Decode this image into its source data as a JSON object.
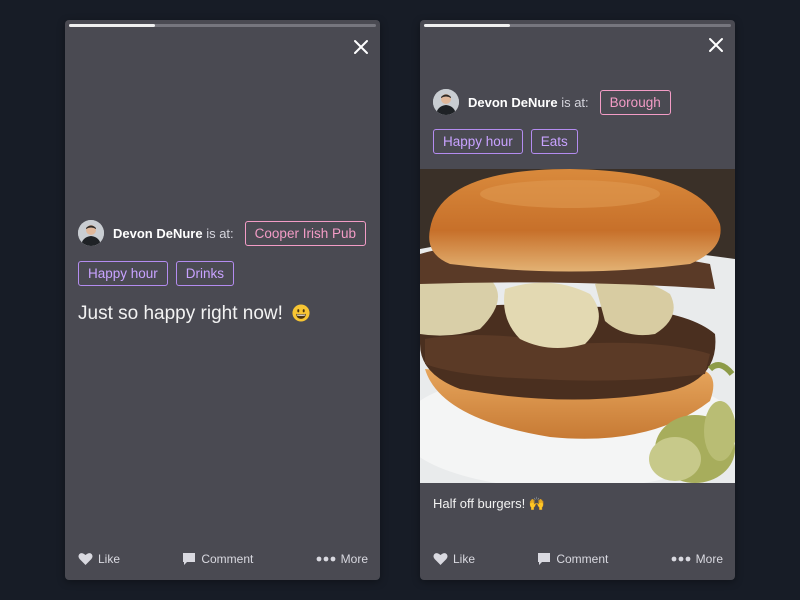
{
  "cards": [
    {
      "progress": 0.28,
      "user": {
        "name": "Devon DeNure",
        "is_at": "is at:"
      },
      "location": "Cooper Irish Pub",
      "tags": [
        "Happy hour",
        "Drinks"
      ],
      "status_text": "Just so happy right now!",
      "status_emoji": "grinning-face",
      "actions": {
        "like": "Like",
        "comment": "Comment",
        "more": "More"
      }
    },
    {
      "progress": 0.28,
      "user": {
        "name": "Devon DeNure",
        "is_at": "is at:"
      },
      "location": "Borough",
      "tags": [
        "Happy hour",
        "Eats"
      ],
      "photo": "burger-photo",
      "caption": "Half off burgers! 🙌",
      "actions": {
        "like": "Like",
        "comment": "Comment",
        "more": "More"
      }
    }
  ],
  "colors": {
    "background": "#171c26",
    "card": "#4a4a52",
    "location_tag": "#f39cc6",
    "tag": "#c8a2ff"
  },
  "icons": [
    "close-icon",
    "heart-icon",
    "comment-icon",
    "more-icon"
  ]
}
